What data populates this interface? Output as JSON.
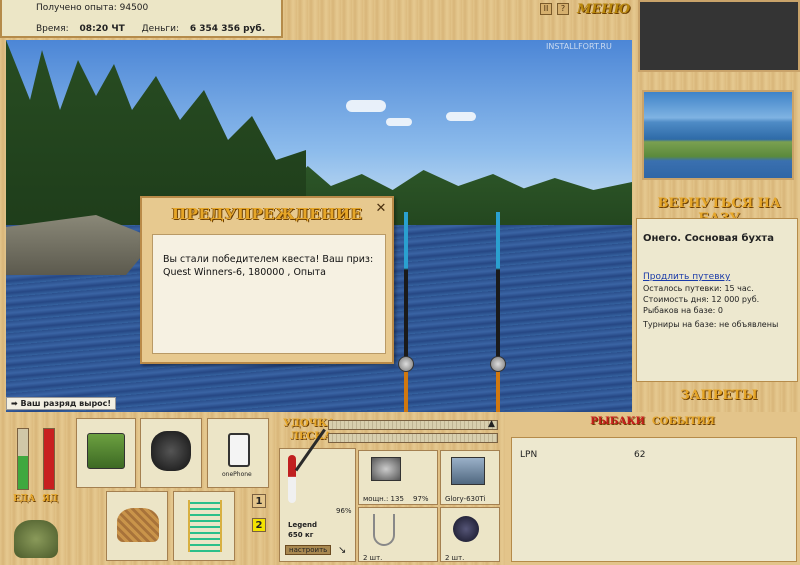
{
  "top_info": {
    "experience_label": "Получено опыта:",
    "experience_value": "94500",
    "time_label": "Время:",
    "time_value": "08:20 ЧТ",
    "money_label": "Деньги:",
    "money_value": "6 354 356 руб."
  },
  "menu": {
    "label": "МЕНЮ",
    "pause_symbol": "II",
    "help_symbol": "?"
  },
  "scene": {
    "watermark": "INSTALLFORT.RU",
    "rank_message": "Ваш разряд вырос!"
  },
  "dialog": {
    "title": "ПРЕДУПРЕЖДЕНИЕ",
    "close_symbol": "✕",
    "message": "Вы стали победителем квеста! Ваш приз: Quest Winners-6, 180000 , Опыта"
  },
  "right_panel": {
    "back_to_base": "ВЕРНУТЬСЯ НА БАЗУ",
    "base_name": "Онего. Сосновая бухта",
    "sell_link": "Продлить путевку",
    "info": [
      "Осталось путевки: 15 час.",
      "Стоимость дня: 12 000 руб.",
      "Рыбаков на базе: 0",
      "Турниры на базе: не объявлены"
    ],
    "bans": "ЗАПРЕТЫ"
  },
  "status": {
    "food_label": "ЕДА",
    "poison_label": "ЯД",
    "food_level": 0.55,
    "poison_level": 1.0,
    "food_color": "#3fa83f",
    "poison_color": "#c82020"
  },
  "inventory": {
    "phone_label": "onePhone",
    "pages": [
      "1",
      "2"
    ],
    "active_page": "2"
  },
  "tackle": {
    "rod_label": "УДОЧКА",
    "line_label": "ЛЕСКА",
    "rod_name": "Legend",
    "rod_capacity": "650 кг",
    "rod_percent": "96%",
    "reel_power": "мощн.: 135",
    "reel_percent": "97%",
    "line_name": "Glory-630Ti",
    "hook_count": "2 шт.",
    "bait_count": "2 шт.",
    "setup_button": "настроить"
  },
  "events": {
    "tab_fishers": "РЫБАКИ",
    "tab_events": "СОБЫТИЯ",
    "rows": [
      {
        "name": "LPN",
        "value": "62"
      }
    ]
  }
}
